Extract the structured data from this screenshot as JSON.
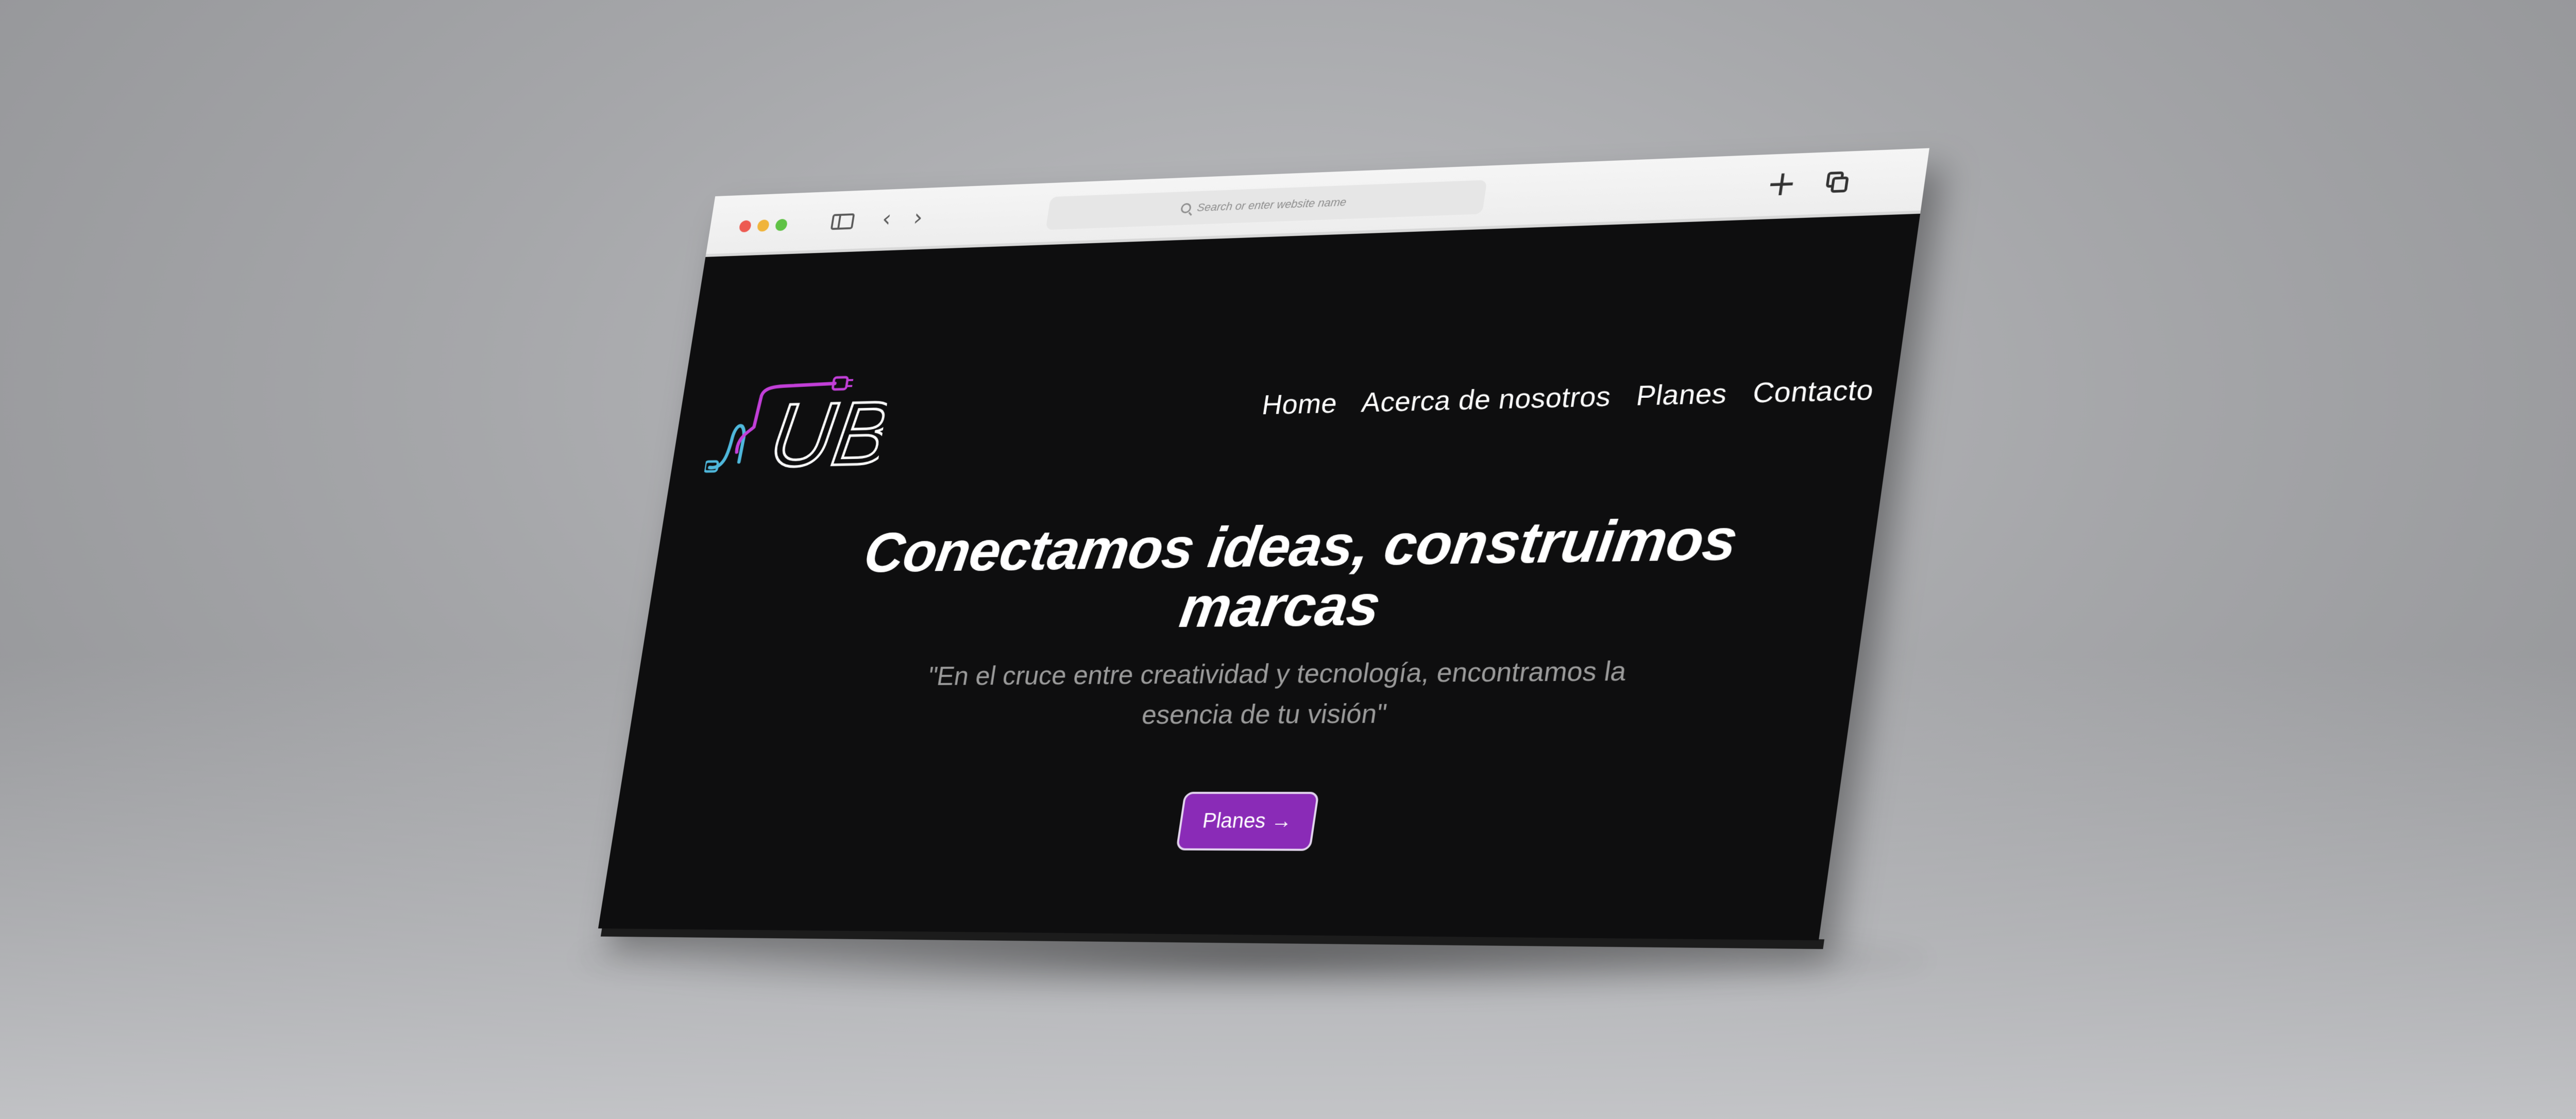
{
  "browser": {
    "address_placeholder": "Search or enter website name",
    "icons": {
      "traffic_lights": [
        "close-icon",
        "minimize-icon",
        "maximize-icon"
      ],
      "sidebar": "sidebar-icon",
      "back": "chevron-left-icon",
      "forward": "chevron-right-icon",
      "search": "search-icon",
      "new_tab": "plus-icon",
      "tabs_overview": "tabs-icon"
    },
    "glyphs": {
      "back": "‹",
      "forward": "›",
      "plus": "+"
    }
  },
  "site": {
    "logo": {
      "text": "UB",
      "colors": {
        "magenta": "#c23fd8",
        "cyan": "#4fb8dc",
        "white": "#ffffff"
      }
    },
    "nav": {
      "items": [
        "Home",
        "Acerca de nosotros",
        "Planes",
        "Contacto"
      ]
    },
    "hero": {
      "headline": "Conectamos ideas, construimos marcas",
      "subtitle": "\"En el cruce entre creatividad y tecnología, encontramos la esencia de tu visión\"",
      "cta_label": "Planes →"
    },
    "colors": {
      "background": "#0e0e0f",
      "accent": "#8a2bb7",
      "subtitle": "#9b9b9b"
    }
  }
}
